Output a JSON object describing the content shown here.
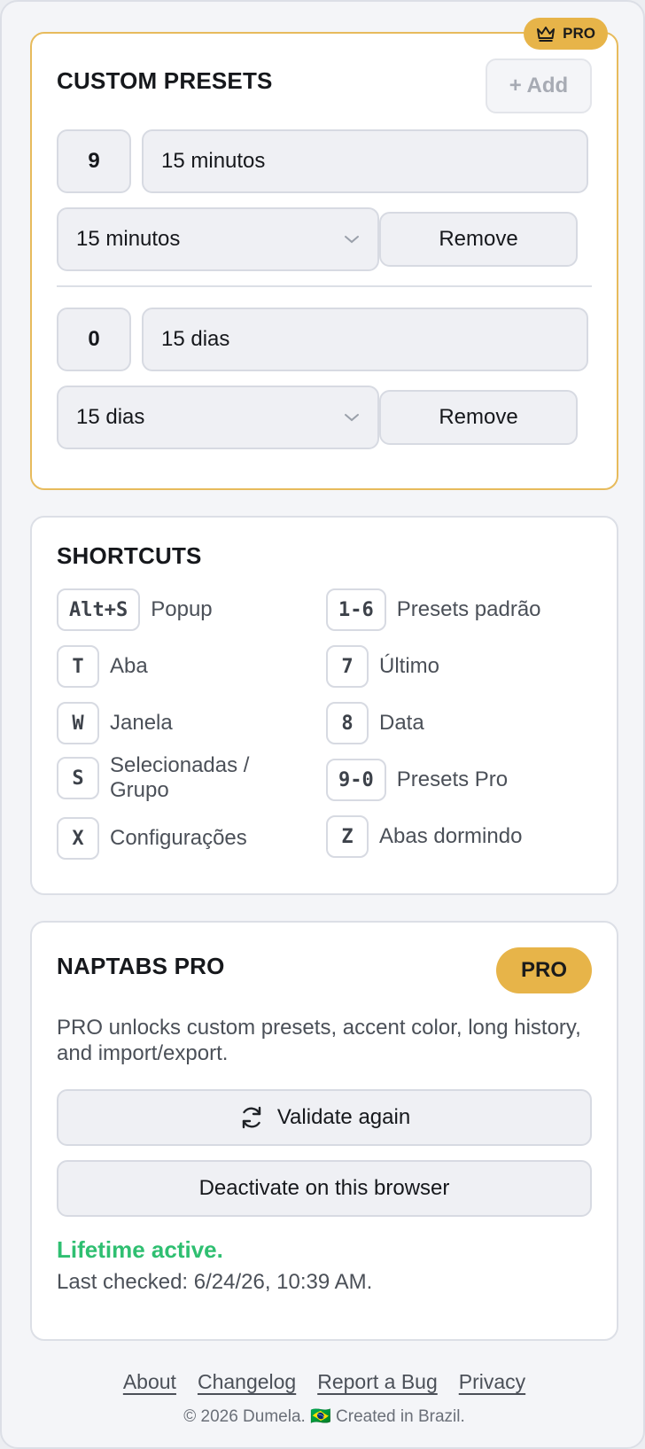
{
  "presets_card": {
    "title": "CUSTOM PRESETS",
    "badge": "PRO",
    "add_label": "+ Add",
    "presets": [
      {
        "key": "9",
        "name": "15 minutos",
        "duration": "15 minutos",
        "remove_label": "Remove"
      },
      {
        "key": "0",
        "name": "15 dias",
        "duration": "15 dias",
        "remove_label": "Remove"
      }
    ]
  },
  "shortcuts_card": {
    "title": "SHORTCUTS",
    "left": [
      {
        "key": "Alt+S",
        "label": "Popup"
      },
      {
        "key": "T",
        "label": "Aba"
      },
      {
        "key": "W",
        "label": "Janela"
      },
      {
        "key": "S",
        "label": "Selecionadas / Grupo"
      },
      {
        "key": "X",
        "label": "Configurações"
      }
    ],
    "right": [
      {
        "key": "1-6",
        "label": "Presets padrão"
      },
      {
        "key": "7",
        "label": "Último"
      },
      {
        "key": "8",
        "label": "Data"
      },
      {
        "key": "9-0",
        "label": "Presets Pro"
      },
      {
        "key": "Z",
        "label": "Abas dormindo"
      }
    ]
  },
  "pro_card": {
    "title": "NAPTABS PRO",
    "badge": "PRO",
    "description": "PRO unlocks custom presets, accent color, long history, and import/export.",
    "validate_label": "Validate again",
    "deactivate_label": "Deactivate on this browser",
    "status": "Lifetime active.",
    "last_checked": "Last checked: 6/24/26, 10:39 AM."
  },
  "footer": {
    "links": [
      "About",
      "Changelog",
      "Report a Bug",
      "Privacy"
    ],
    "copyright": "© 2026 Dumela. 🇧🇷 Created in Brazil."
  },
  "colors": {
    "accent_gold": "#e7b449",
    "status_green": "#2fbf71"
  }
}
